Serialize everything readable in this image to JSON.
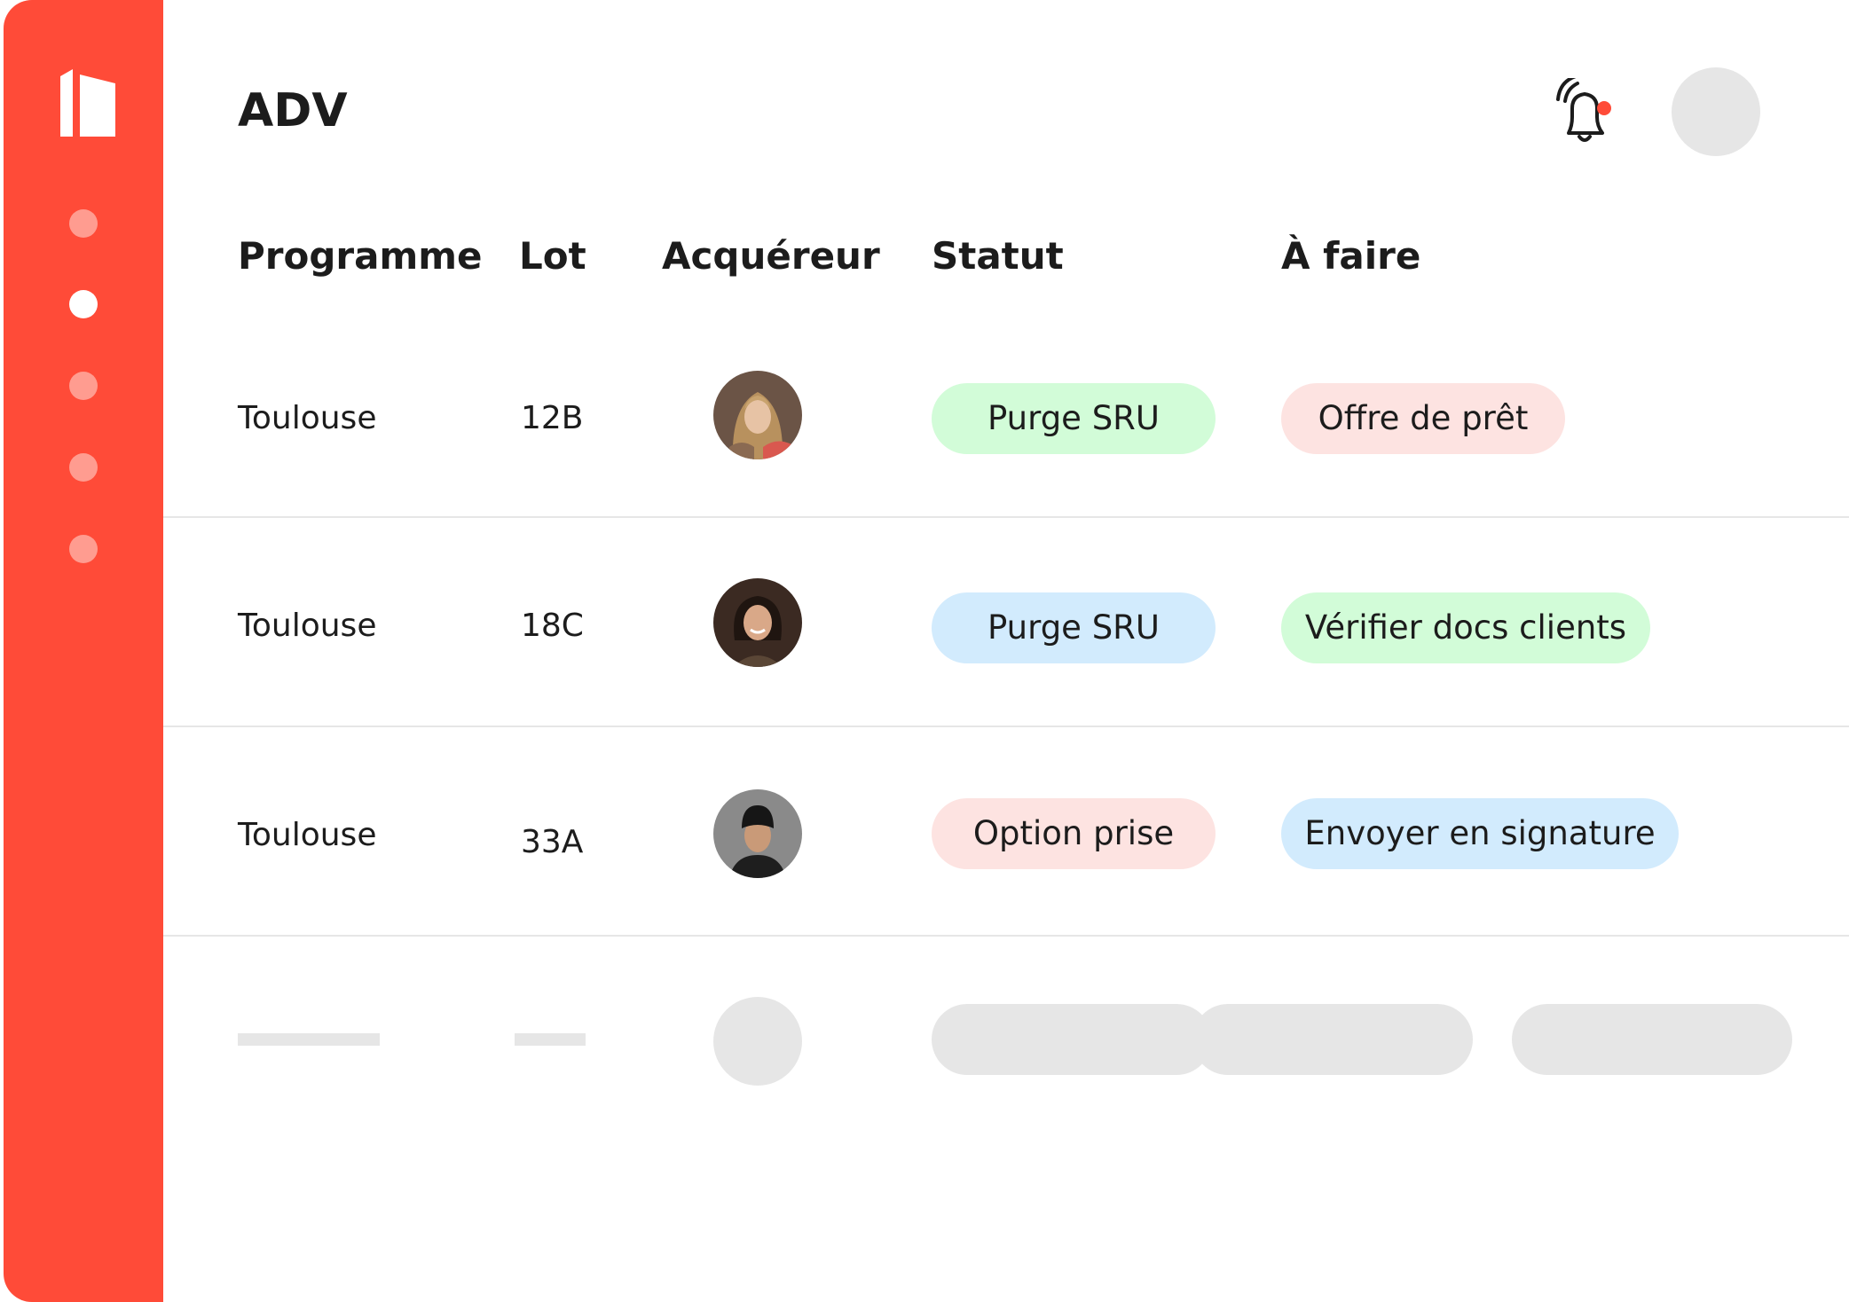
{
  "app": {
    "title": "ADV"
  },
  "sidebar": {
    "logo_icon": "building-logo-icon",
    "nav_items": [
      {
        "name": "nav-item-1",
        "active": false
      },
      {
        "name": "nav-item-2",
        "active": true
      },
      {
        "name": "nav-item-3",
        "active": false
      },
      {
        "name": "nav-item-4",
        "active": false
      },
      {
        "name": "nav-item-5",
        "active": false
      }
    ],
    "colors": {
      "background": "#ff4b38",
      "dot": "#ff9c90",
      "dot_active": "#ffffff"
    }
  },
  "header": {
    "notification_icon": "bell-ringing-icon",
    "notification_badge": true
  },
  "table": {
    "columns": [
      "Programme",
      "Lot",
      "Acquéreur",
      "Statut",
      "À faire"
    ],
    "rows": [
      {
        "programme": "Toulouse",
        "lot": "12B",
        "acquereur_icon": "avatar-woman-long-hair",
        "statut": "Purge SRU",
        "statut_color": "#d2fcd8",
        "a_faire": "Offre de prêt",
        "a_faire_color": "#fde3e1"
      },
      {
        "programme": "Toulouse",
        "lot": "18C",
        "acquereur_icon": "avatar-woman-smiling",
        "statut": "Purge SRU",
        "statut_color": "#d2ebfd",
        "a_faire": "Vérifier docs clients",
        "a_faire_color": "#d2fcd8"
      },
      {
        "programme": "Toulouse",
        "lot": "33A",
        "acquereur_icon": "avatar-man-beanie",
        "statut": "Option prise",
        "statut_color": "#fde3e1",
        "a_faire": "Envoyer en signature",
        "a_faire_color": "#d2ebfd"
      }
    ],
    "placeholder_row": true
  }
}
